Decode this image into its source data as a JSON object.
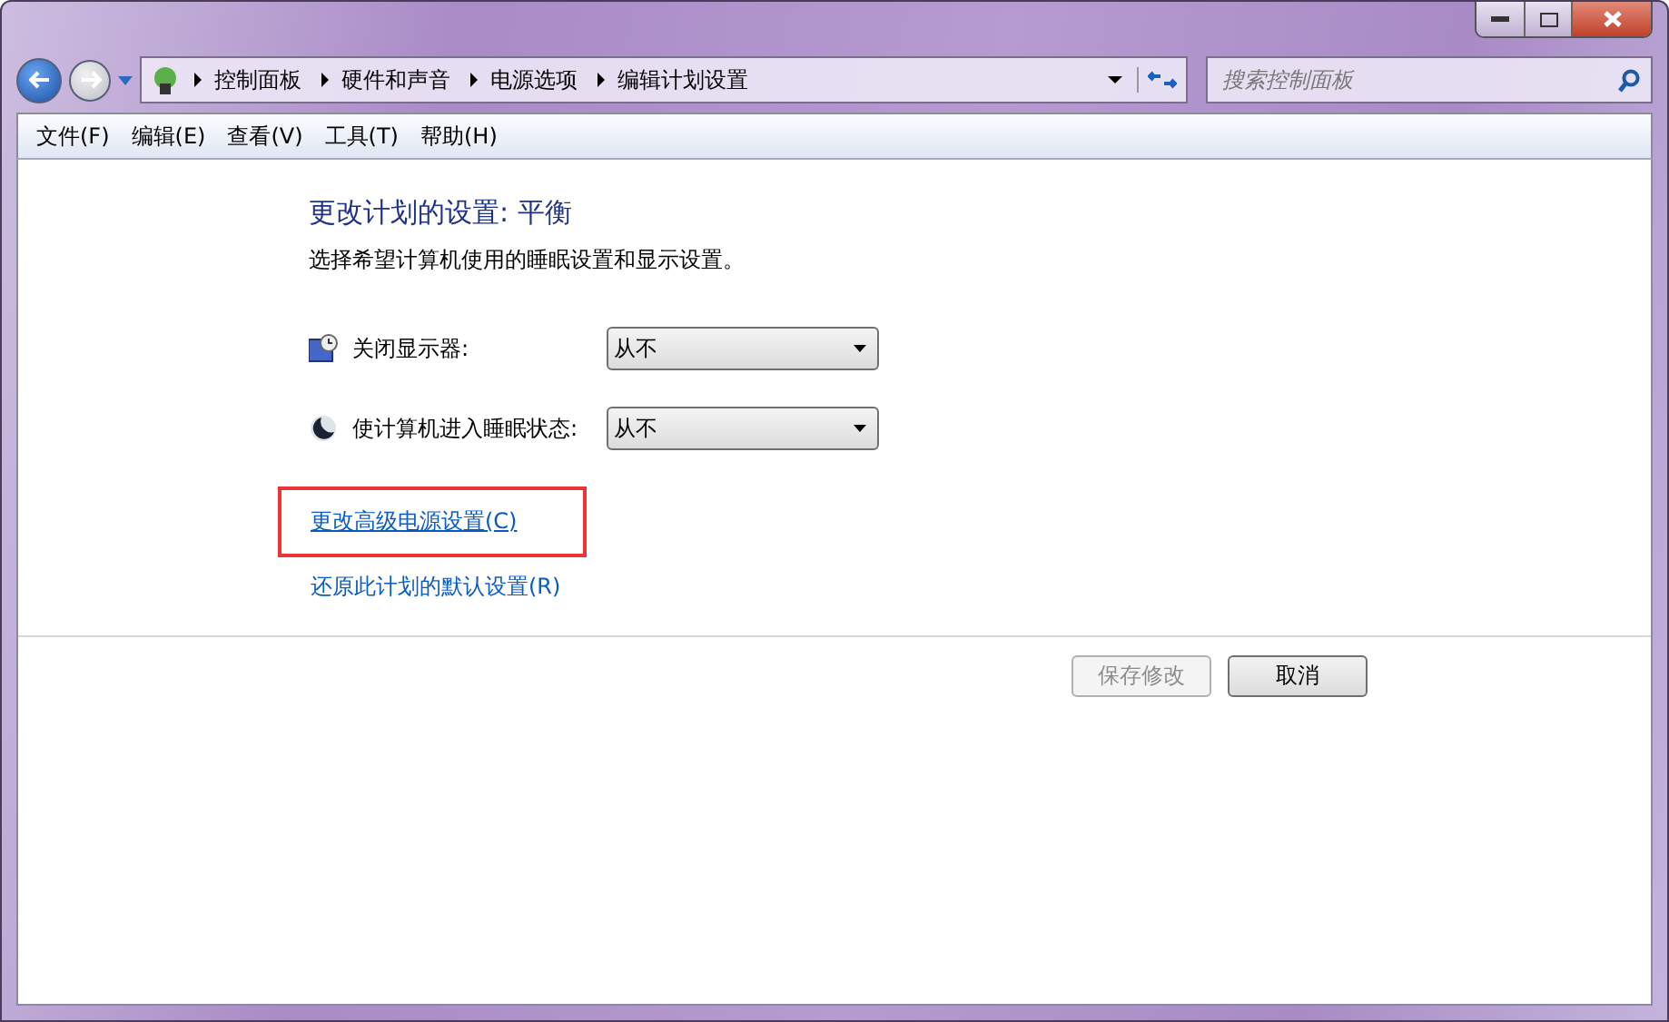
{
  "breadcrumb": [
    "控制面板",
    "硬件和声音",
    "电源选项",
    "编辑计划设置"
  ],
  "search": {
    "placeholder": "搜索控制面板"
  },
  "menu": [
    {
      "label": "文件(F)"
    },
    {
      "label": "编辑(E)"
    },
    {
      "label": "查看(V)"
    },
    {
      "label": "工具(T)"
    },
    {
      "label": "帮助(H)"
    }
  ],
  "heading": "更改计划的设置: 平衡",
  "description": "选择希望计算机使用的睡眠设置和显示设置。",
  "settings": [
    {
      "kind": "display",
      "label": "关闭显示器:",
      "value": "从不"
    },
    {
      "kind": "sleep",
      "label": "使计算机进入睡眠状态:",
      "value": "从不"
    }
  ],
  "links": [
    {
      "label": "更改高级电源设置(C)",
      "highlighted": true
    },
    {
      "label": "还原此计划的默认设置(R)",
      "highlighted": false
    }
  ],
  "buttons": [
    {
      "label": "保存修改",
      "disabled": true
    },
    {
      "label": "取消",
      "disabled": false
    }
  ]
}
